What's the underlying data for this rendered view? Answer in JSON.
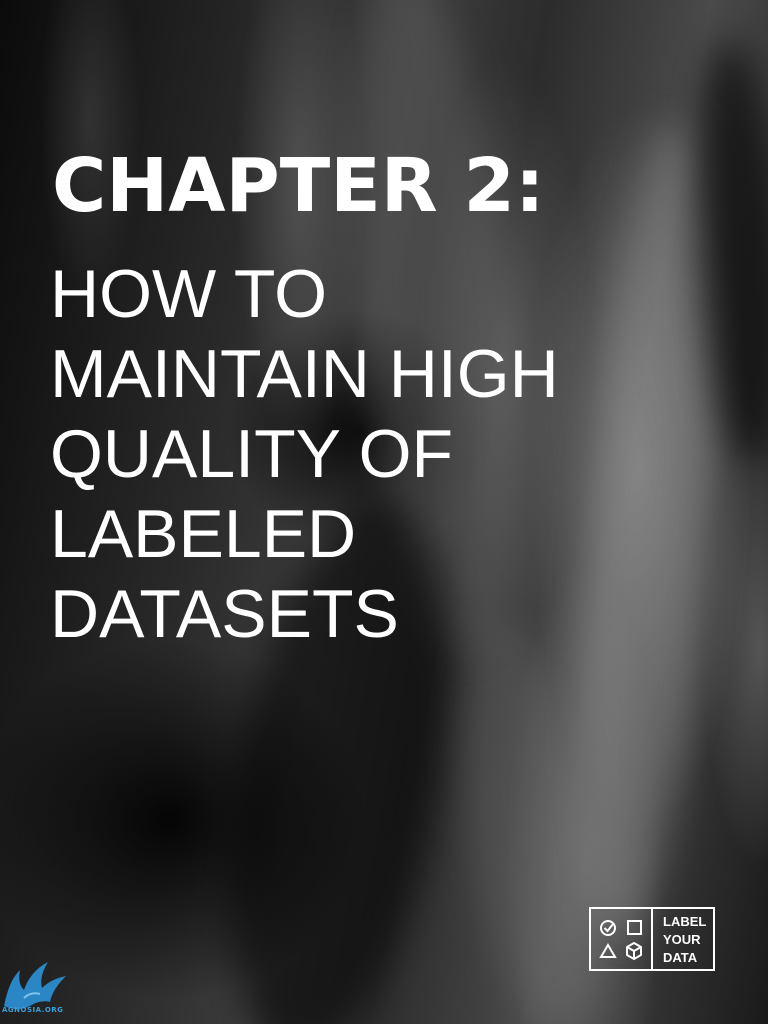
{
  "cover": {
    "title": "CHAPTER 2:",
    "subtitle_lines": [
      "HOW TO",
      "MAINTAIN HIGH",
      "QUALITY OF",
      "LABELED",
      "DATASETS"
    ]
  },
  "logo": {
    "lines": [
      "LABEL",
      "YOUR",
      "DATA"
    ],
    "icons": [
      "check-circle-icon",
      "square-icon",
      "triangle-icon",
      "cube-icon"
    ]
  },
  "watermark": {
    "text": "AGNOSIA.ORG",
    "icon": "bird-icon",
    "color": "#3aa0d8"
  },
  "colors": {
    "text": "#ffffff",
    "background": "#050505"
  }
}
